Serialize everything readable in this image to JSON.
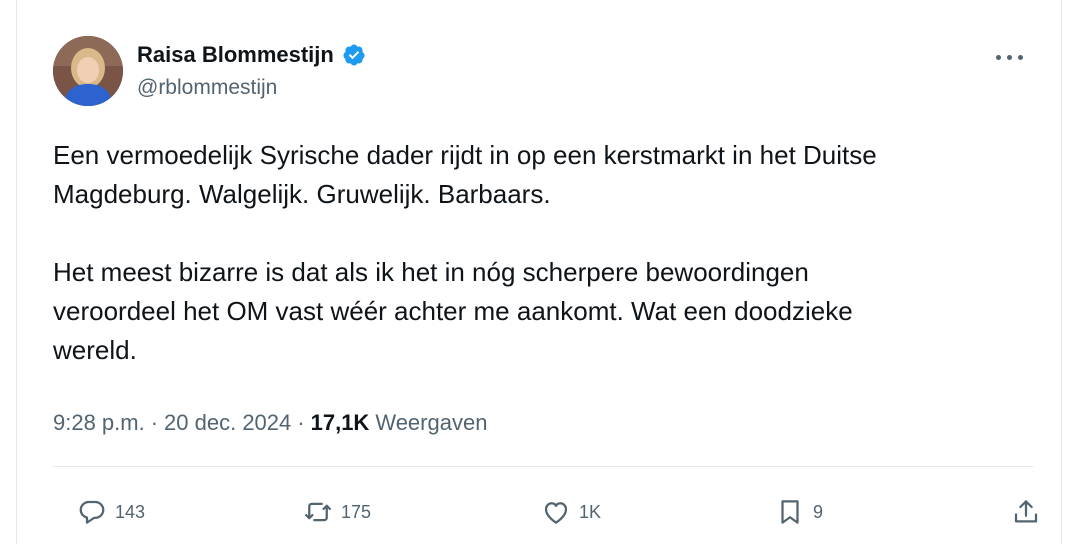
{
  "author": {
    "display_name": "Raisa Blommestijn",
    "handle": "@rblommestijn",
    "verified": true,
    "avatar_icon": "profile-photo"
  },
  "tweet": {
    "paragraphs": [
      "Een vermoedelijk Syrische dader rijdt in op een kerstmarkt in het Duitse\nMagdeburg. Walgelijk. Gruwelijk. Barbaars.",
      "Het meest bizarre is dat als ik het in nóg scherpere bewoordingen\nveroordeel het OM vast wéér achter me aankomt. Wat een doodzieke\nwereld."
    ],
    "time": "9:28 p.m.",
    "separator": "·",
    "date": "20 dec. 2024",
    "views_count": "17,1K",
    "views_label": "Weergaven"
  },
  "actions": {
    "replies": "143",
    "reposts": "175",
    "likes": "1K",
    "bookmarks": "9"
  },
  "colors": {
    "text": "#0f1419",
    "muted": "#536471",
    "verified": "#1d9bf0",
    "divider": "#e6e9ec"
  }
}
